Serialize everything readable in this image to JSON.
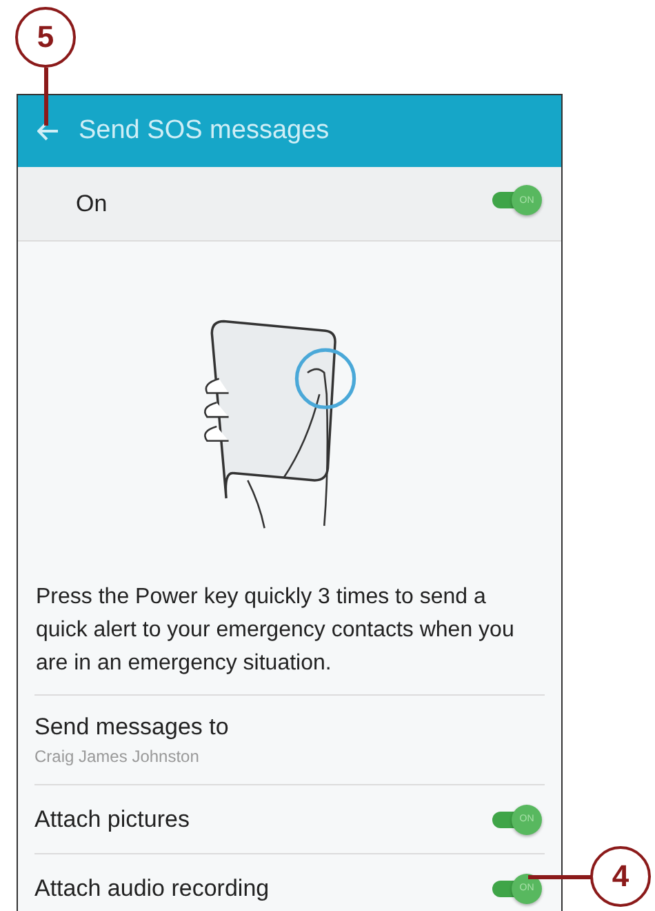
{
  "header": {
    "title": "Send SOS messages"
  },
  "master": {
    "label": "On",
    "toggle_text": "ON",
    "on": true
  },
  "description": "Press the Power key quickly 3 times to send a quick alert to your emergency contacts when you are in an emergency situation.",
  "settings": [
    {
      "kind": "value",
      "label": "Send messages to",
      "value": "Craig James Johnston"
    },
    {
      "kind": "switch",
      "label": "Attach pictures",
      "toggle_text": "ON",
      "on": true
    },
    {
      "kind": "switch",
      "label": "Attach audio recording",
      "toggle_text": "ON",
      "on": true
    }
  ],
  "callouts": [
    {
      "number": "5"
    },
    {
      "number": "4"
    }
  ]
}
